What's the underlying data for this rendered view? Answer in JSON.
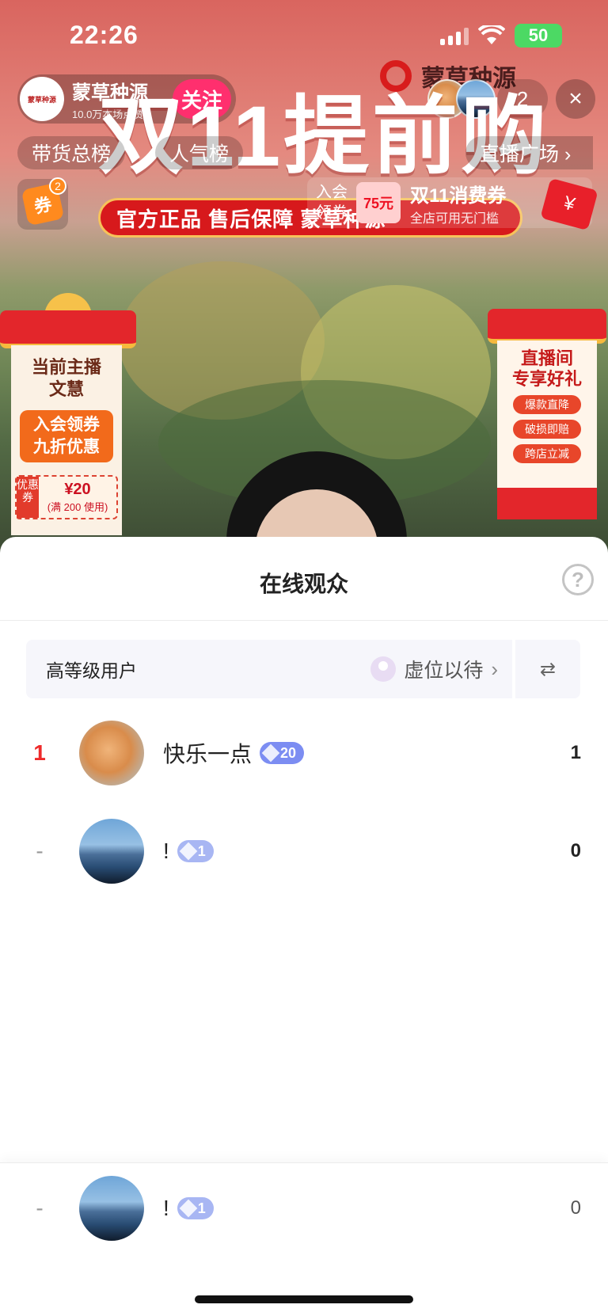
{
  "status_bar": {
    "time": "22:26",
    "battery": "50"
  },
  "stream": {
    "host_name": "蒙草种源",
    "host_logo_text": "蒙草种源",
    "host_likes": "10.0万本场点赞",
    "follow_label": "关注",
    "viewer_count": "2",
    "close_icon": "×",
    "tabs": {
      "sales_rank": "带货总榜",
      "popularity_rank": "人气榜",
      "live_square": "直播广场 ›"
    },
    "brand_mark": "蒙草种源",
    "headline": "双11提前购",
    "banner_text": "官方正品  售后保障  蒙草种源",
    "coupon_icon_text": "券",
    "coupon_badge": "2",
    "member": {
      "join_text_1": "入会",
      "join_text_2": "领券",
      "price": "75元",
      "coupon_title": "双11消费券",
      "coupon_sub": "全店可用无门槛"
    },
    "red_packet_icon": "¥",
    "gift_left": {
      "title_1": "当前主播",
      "title_2": "文慧",
      "btn_1": "入会领券",
      "btn_2": "九折优惠",
      "coupon_tag": "优惠券",
      "coupon_amount": "¥20",
      "coupon_cond": "(满 200 使用)"
    },
    "gift_right": {
      "title_1": "直播间",
      "title_2": "专享好礼",
      "tags": [
        "爆款直降",
        "破损即赔",
        "跨店立减"
      ]
    }
  },
  "sheet": {
    "title": "在线观众",
    "help_icon": "?",
    "level_label": "高等级用户",
    "level_status": "虚位以待",
    "level_chevron": "›",
    "swap_icon": "⇄",
    "viewers": [
      {
        "rank": "1",
        "name": "快乐一点",
        "level": "20",
        "score": "1"
      },
      {
        "rank": "-",
        "name": "!",
        "level": "1",
        "score": "0"
      }
    ],
    "me": {
      "rank": "-",
      "name": "!",
      "level": "1",
      "score": "0"
    }
  },
  "colors": {
    "rank_first": "#ee2b2b",
    "badge_high": "#7c8df2",
    "badge_low": "#a8b6f3",
    "follow": "#ff2f6e"
  }
}
